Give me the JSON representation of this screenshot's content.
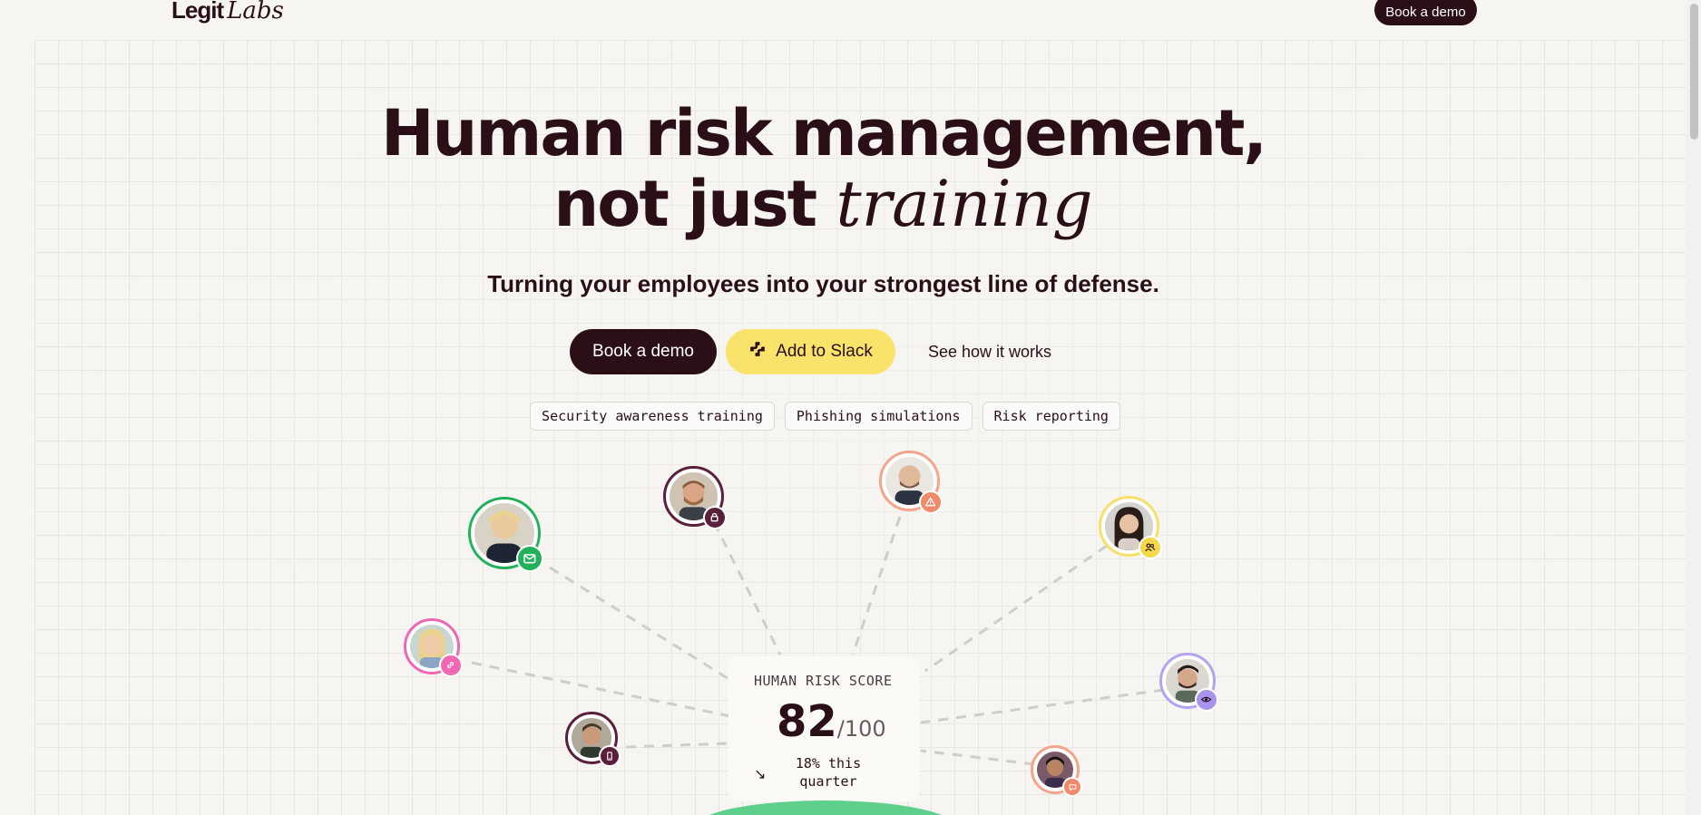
{
  "header": {
    "logo_main": "Legit",
    "logo_script": "Labs",
    "cta_label": "Book a demo"
  },
  "hero": {
    "title_line1": "Human risk management,",
    "title_line2_main": "not just",
    "title_line2_script": "training",
    "subtitle": "Turning your employees into your strongest line of defense."
  },
  "actions": {
    "book_demo": "Book a demo",
    "add_to_slack": "Add to Slack",
    "see_how": "See how it works"
  },
  "tags": [
    "Security awareness training",
    "Phishing simulations",
    "Risk reporting"
  ],
  "score_card": {
    "label": "HUMAN RISK SCORE",
    "value": "82",
    "max": "/100",
    "trend_icon": "↘",
    "trend_text": "18% this quarter"
  },
  "avatars": [
    {
      "name": "avatar-mail",
      "badge_icon": "mail-icon",
      "ring": "#1fb25a",
      "badge": "#1fb25a"
    },
    {
      "name": "avatar-lock",
      "badge_icon": "lock-icon",
      "ring": "#5a1f3a",
      "badge": "#5a1f3a"
    },
    {
      "name": "avatar-alert",
      "badge_icon": "alert-icon",
      "ring": "#f4a48a",
      "badge": "#f08a6a"
    },
    {
      "name": "avatar-users",
      "badge_icon": "users-icon",
      "ring": "#f5e06a",
      "badge": "#f3d84a"
    },
    {
      "name": "avatar-link",
      "badge_icon": "link-icon",
      "ring": "#f068b4",
      "badge": "#f068b4"
    },
    {
      "name": "avatar-eye",
      "badge_icon": "eye-icon",
      "ring": "#b4a4f0",
      "badge": "#a694ee"
    },
    {
      "name": "avatar-phone",
      "badge_icon": "phone-icon",
      "ring": "#5a1f3a",
      "badge": "#5a1f3a"
    },
    {
      "name": "avatar-chat",
      "badge_icon": "chat-icon",
      "ring": "#f4a48a",
      "badge": "#f08a6a"
    }
  ],
  "colors": {
    "primary": "#2a0f17",
    "slack_yellow": "#f9e36a",
    "background": "#f6f5f1",
    "gauge_green": "#5fcf8c"
  }
}
